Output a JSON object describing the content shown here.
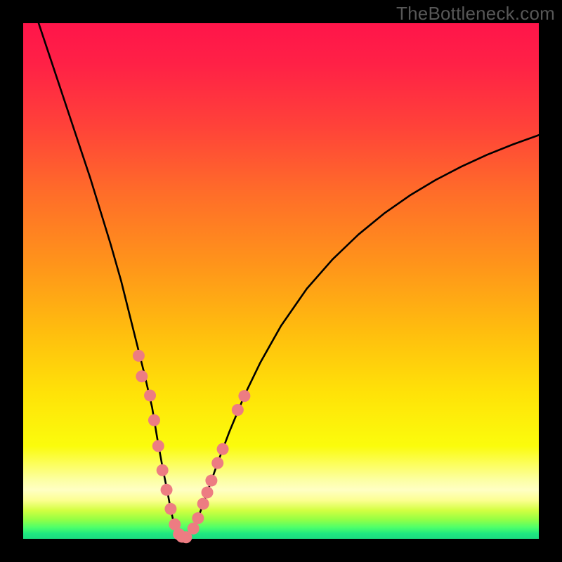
{
  "watermark": "TheBottleneck.com",
  "colors": {
    "bg_black": "#000000",
    "curve_stroke": "#000000",
    "dot_fill": "#ed7c82",
    "watermark_text": "#575757",
    "gradient_stops": [
      {
        "offset": 0.0,
        "color": "#ff154a"
      },
      {
        "offset": 0.08,
        "color": "#ff2146"
      },
      {
        "offset": 0.2,
        "color": "#ff4239"
      },
      {
        "offset": 0.33,
        "color": "#ff6d29"
      },
      {
        "offset": 0.47,
        "color": "#ff951a"
      },
      {
        "offset": 0.6,
        "color": "#ffbe0e"
      },
      {
        "offset": 0.72,
        "color": "#ffe308"
      },
      {
        "offset": 0.82,
        "color": "#fbfc0c"
      },
      {
        "offset": 0.885,
        "color": "#fcffa2"
      },
      {
        "offset": 0.905,
        "color": "#ffffc4"
      },
      {
        "offset": 0.925,
        "color": "#fcff92"
      },
      {
        "offset": 0.945,
        "color": "#d2ff41"
      },
      {
        "offset": 0.962,
        "color": "#97ff44"
      },
      {
        "offset": 0.978,
        "color": "#4dff6b"
      },
      {
        "offset": 0.99,
        "color": "#1fe880"
      },
      {
        "offset": 1.0,
        "color": "#1bdb7f"
      }
    ]
  },
  "chart_data": {
    "type": "line",
    "title": "",
    "xlabel": "",
    "ylabel": "",
    "xlim": [
      0,
      100
    ],
    "ylim": [
      0,
      100
    ],
    "grid": false,
    "legend": false,
    "series": [
      {
        "name": "bottleneck-curve",
        "x": [
          3,
          5,
          7,
          9,
          11,
          13,
          15,
          17,
          19,
          20.5,
          22,
          23.5,
          25,
          26,
          27,
          28,
          28.5,
          29,
          29.5,
          30,
          30.6,
          31.2,
          32,
          33,
          34,
          35,
          36,
          38,
          40,
          43,
          46,
          50,
          55,
          60,
          65,
          70,
          75,
          80,
          85,
          90,
          95,
          100
        ],
        "y": [
          100,
          94,
          88,
          82,
          76,
          70,
          63.5,
          57,
          50,
          44,
          38,
          32,
          25.5,
          19.5,
          14,
          9,
          6.3,
          4,
          2.2,
          1.1,
          0.45,
          0.2,
          0.55,
          2,
          4.3,
          7,
          9.9,
          15.5,
          20.8,
          28,
          34.2,
          41.3,
          48.5,
          54.2,
          59,
          63.1,
          66.6,
          69.6,
          72.2,
          74.5,
          76.5,
          78.3
        ]
      }
    ],
    "scatter_overlay": {
      "name": "sample-dots",
      "dot_radius_px": 8.5,
      "points": [
        {
          "x": 22.4,
          "y": 35.5
        },
        {
          "x": 23.0,
          "y": 31.5
        },
        {
          "x": 24.6,
          "y": 27.8
        },
        {
          "x": 25.4,
          "y": 23.0
        },
        {
          "x": 26.2,
          "y": 18.0
        },
        {
          "x": 27.0,
          "y": 13.3
        },
        {
          "x": 27.8,
          "y": 9.5
        },
        {
          "x": 28.6,
          "y": 5.8
        },
        {
          "x": 29.4,
          "y": 2.8
        },
        {
          "x": 30.2,
          "y": 0.9
        },
        {
          "x": 30.8,
          "y": 0.4
        },
        {
          "x": 31.6,
          "y": 0.3
        },
        {
          "x": 33.0,
          "y": 2.0
        },
        {
          "x": 33.9,
          "y": 4.0
        },
        {
          "x": 34.9,
          "y": 6.8
        },
        {
          "x": 35.7,
          "y": 9.0
        },
        {
          "x": 36.5,
          "y": 11.3
        },
        {
          "x": 37.7,
          "y": 14.7
        },
        {
          "x": 38.7,
          "y": 17.4
        },
        {
          "x": 41.6,
          "y": 25.0
        },
        {
          "x": 42.9,
          "y": 27.7
        }
      ]
    }
  }
}
